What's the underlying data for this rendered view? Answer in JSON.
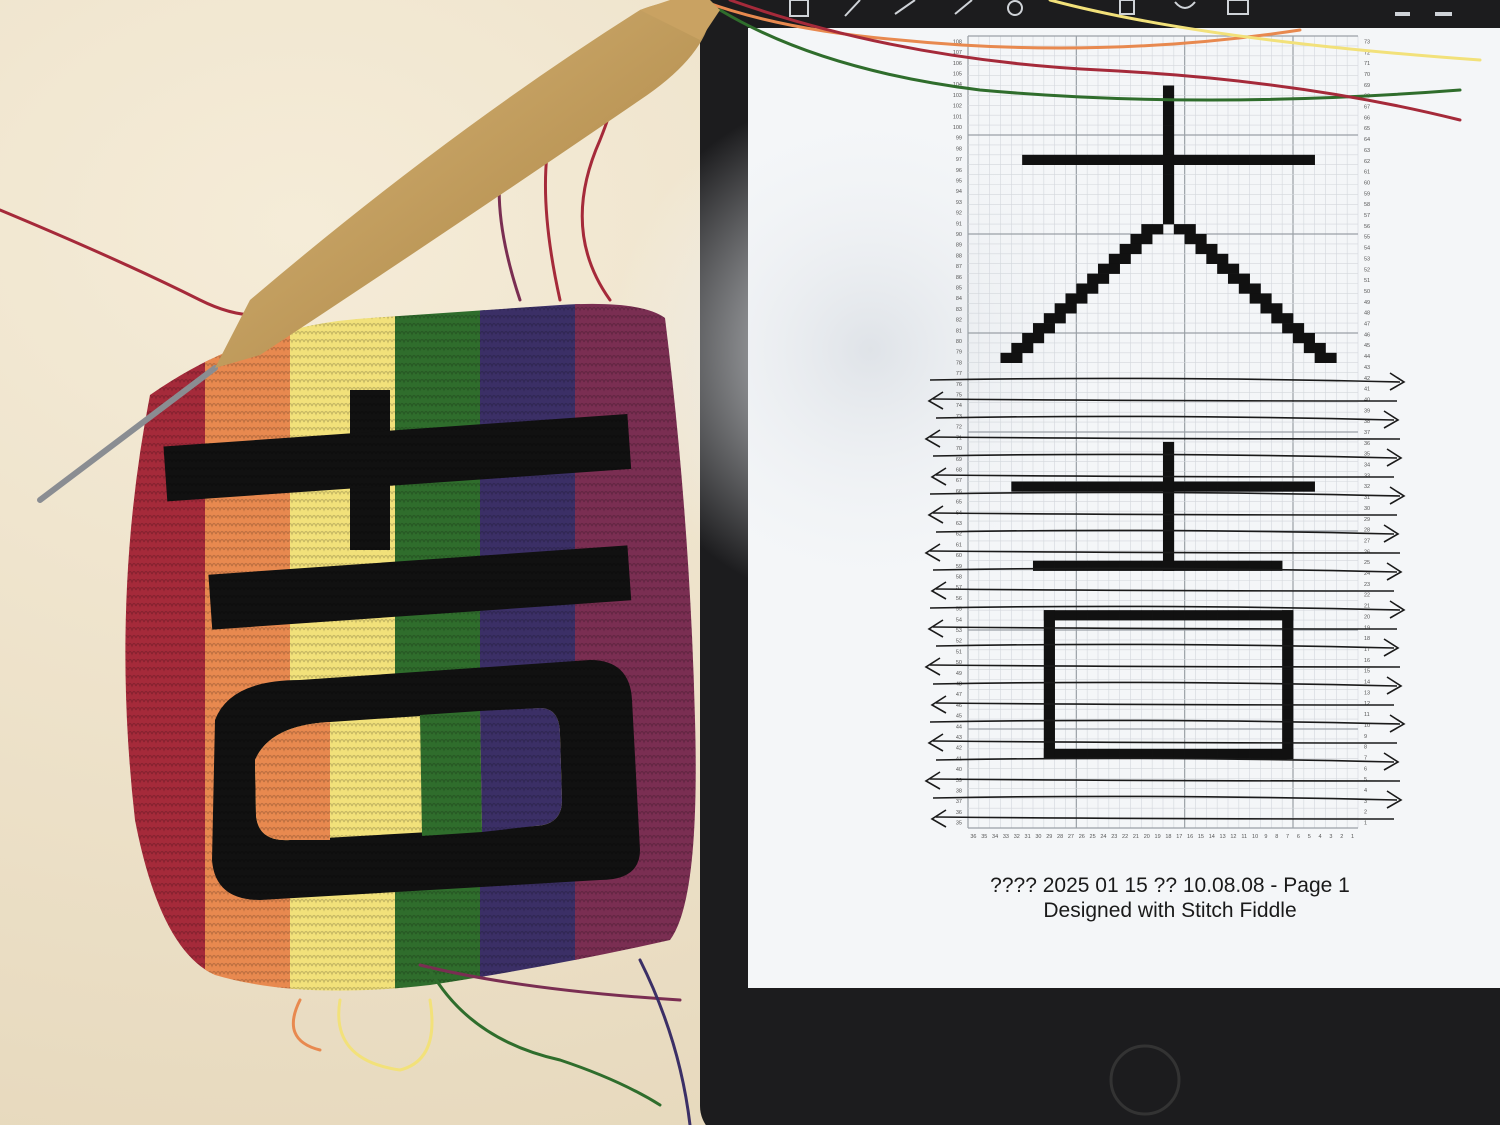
{
  "tablet": {
    "caption": {
      "line1": "???? 2025 01 15 ?? 10.08.08 - Page 1",
      "line2": "Designed with Stitch Fiddle"
    },
    "toolbar_icons": [
      "add-page-icon",
      "pen-icon",
      "eraser-icon",
      "highlighter-icon",
      "lasso-icon",
      "shapes-icon",
      "image-icon",
      "keyboard-icon",
      "minimize-icon"
    ]
  },
  "chart_grid": {
    "columns": 36,
    "rows": 108,
    "left_row_numbers": [
      "108",
      "107",
      "106",
      "105",
      "104",
      "103",
      "102",
      "101",
      "100",
      "99",
      "98",
      "97",
      "96",
      "95",
      "94",
      "93",
      "92",
      "91",
      "90",
      "89",
      "88",
      "87",
      "86",
      "85",
      "84",
      "83",
      "82",
      "81",
      "80",
      "79",
      "78",
      "77",
      "76",
      "75",
      "74",
      "73",
      "72",
      "71",
      "70",
      "69",
      "68",
      "67",
      "66",
      "65",
      "64",
      "63",
      "62",
      "61",
      "60",
      "59",
      "58",
      "57",
      "56",
      "55",
      "54",
      "53",
      "52",
      "51",
      "50",
      "49",
      "48",
      "47",
      "46",
      "45",
      "44",
      "43",
      "42",
      "41",
      "40",
      "39",
      "38",
      "37",
      "36",
      "35"
    ],
    "right_row_numbers": [
      "73",
      "72",
      "71",
      "70",
      "69",
      "68",
      "67",
      "66",
      "65",
      "64",
      "63",
      "62",
      "61",
      "60",
      "59",
      "58",
      "57",
      "56",
      "55",
      "54",
      "53",
      "52",
      "51",
      "50",
      "49",
      "48",
      "47",
      "46",
      "45",
      "44",
      "43",
      "42",
      "41",
      "40",
      "39",
      "38",
      "37",
      "36",
      "35",
      "34",
      "33",
      "32",
      "31",
      "30",
      "29",
      "28",
      "27",
      "26",
      "25",
      "24",
      "23",
      "22",
      "21",
      "20",
      "19",
      "18",
      "17",
      "16",
      "15",
      "14",
      "13",
      "12",
      "11",
      "10",
      "9",
      "8",
      "7",
      "6",
      "5",
      "4",
      "3",
      "2",
      "1"
    ],
    "column_numbers": [
      "36",
      "35",
      "34",
      "33",
      "32",
      "31",
      "30",
      "29",
      "28",
      "27",
      "26",
      "25",
      "24",
      "23",
      "22",
      "21",
      "20",
      "19",
      "18",
      "17",
      "16",
      "15",
      "14",
      "13",
      "12",
      "11",
      "10",
      "9",
      "8",
      "7",
      "6",
      "5",
      "4",
      "3",
      "2",
      "1"
    ]
  },
  "colors": {
    "background": "#efe5cf",
    "tablet_bezel": "#1c1c1e",
    "screen": "#f4f6f8",
    "chart_cell": "#111111",
    "yarn": [
      "#a52a3a",
      "#e8894f",
      "#f2e17a",
      "#2f6d2c",
      "#3b2f66",
      "#7a2e52",
      "#111111"
    ]
  }
}
